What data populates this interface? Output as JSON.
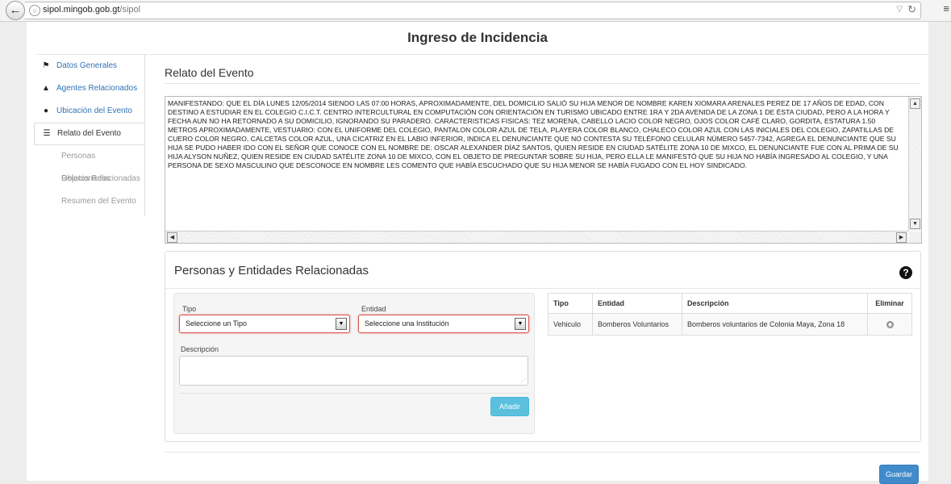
{
  "browser": {
    "url_host": "sipol.mingob.gob.gt",
    "url_path": "/sipol"
  },
  "page": {
    "title": "Ingreso de Incidencia"
  },
  "sidebar": {
    "items": [
      {
        "label": "Datos Generales",
        "icon": "flag-icon",
        "state": "link"
      },
      {
        "label": "Agentes Relacionados",
        "icon": "user-icon",
        "state": "link"
      },
      {
        "label": "Ubicación del Evento",
        "icon": "map-marker-icon",
        "state": "link"
      },
      {
        "label": "Relato del Evento",
        "icon": "list-icon",
        "state": "active"
      },
      {
        "label": "Personas Relacionadas",
        "state": "disabled"
      },
      {
        "label": "Objetos Relacionadas",
        "state": "disabled"
      },
      {
        "label": "Resumen del Evento",
        "state": "disabled"
      }
    ]
  },
  "relato": {
    "heading": "Relato del Evento",
    "text": "MANIFESTANDO: QUE EL DÍA LUNES 12/05/2014 SIENDO LAS 07:00 HORAS, APROXIMADAMENTE, DEL DOMICILIO SALIÓ SU HIJA MENOR DE NOMBRE KAREN XIOMARA ARENALES PEREZ DE 17 AÑOS DE EDAD, CON DESTINO A ESTUDIAR EN EL COLEGIO C.I.C.T. CENTRO INTERCULTURAL EN COMPUTACIÓN CON ORIENTACIÓN EN TURISMO UBICADO ENTRE 1RA Y 2DA AVENIDA DE LA ZONA 1 DE ÉSTA CIUDAD, PERO A LA HORA Y FECHA AUN NO HA RETORNADO A SU DOMICILIO, IGNORANDO SU PARADERO.  CARACTERISTICAS FISICAS: TEZ MORENA, CABELLO LACIO COLOR NEGRO, OJOS COLOR CAFÉ CLARO, GORDITA, ESTATURA 1.50 METROS APROXIMADAMENTE, VESTUARIO: CON EL UNIFORME DEL COLEGIO, PANTALON COLOR AZUL DE TELA, PLAYERA COLOR BLANCO, CHALECO COLOR AZUL CON LAS INICIALES DEL COLEGIO, ZAPATILLAS DE CUERO COLOR NEGRO, CALCETAS COLOR AZUL, UNA CICATRIZ EN EL LABIO INFERIOR, INDICA EL DENUNCIANTE QUE NO CONTESTA SU TELÉFONO CELULAR NÚMERO 5457-7342, AGREGA EL DENUNCIANTE QUE SU HIJA SE PUDO HABER IDO CON EL SEÑOR QUE CONOCE CON EL NOMBRE DE: OSCAR ALEXANDER DÍAZ SANTOS, QUIEN RESIDE EN CIUDAD SATÉLITE ZONA 10 DE MIXCO, EL DENUNCIANTE FUE CON AL PRIMA DE SU HIJA ALYSON NUÑEZ, QUIEN RESIDE EN CIUDAD SATÉLITE ZONA 10 DE MIXCO, CON EL OBJETO DE PREGUNTAR SOBRE SU HIJA, PERO ELLA LE MANIFESTÓ QUE SU HIJA NO HABÍA INGRESADO AL COLEGIO, Y UNA PERSONA DE SEXO MASCULINO QUE DESCONOCE EN NOMBRE LES COMENTO QUE HABÍA ESCUCHADO QUE SU HIJA MENOR SE HABÍA FUGADO CON EL HOY SINDICADO."
  },
  "personas": {
    "heading": "Personas y Entidades Relacionadas",
    "form": {
      "tipo_label": "Tipo",
      "tipo_value": "Seleccione un Tipo",
      "entidad_label": "Entidad",
      "entidad_value": "Seleccione una Institución",
      "descripcion_label": "Descripción",
      "descripcion_value": "",
      "add_button": "Añadir"
    },
    "table": {
      "headers": [
        "Tipo",
        "Entidad",
        "Descripción",
        "Eliminar"
      ],
      "rows": [
        {
          "tipo": "Vehiculo",
          "entidad": "Bomberos Voluntarios",
          "descripcion": "Bomberos voluntarios de Colonia Maya, Zona 18"
        }
      ]
    }
  },
  "actions": {
    "save_button": "Guardar"
  },
  "colors": {
    "link": "#2f73b7",
    "info_button": "#5bc0de",
    "primary_button": "#428bca",
    "error_border": "#d9534f"
  }
}
